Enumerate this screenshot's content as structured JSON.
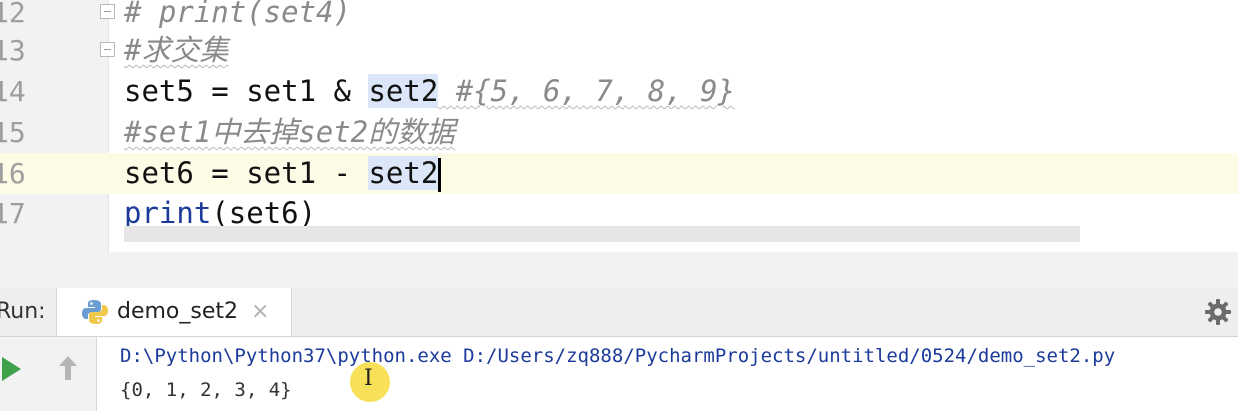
{
  "editor": {
    "lines": [
      {
        "number": "12",
        "text": "# print(set4)"
      },
      {
        "number": "13",
        "text": "#求交集"
      },
      {
        "number": "14",
        "code_a": "set5 = set1 & ",
        "code_hl": "set2",
        "comment": " #{5, 6, 7, 8, 9}"
      },
      {
        "number": "15",
        "text": "#set1中去掉set2的数据"
      },
      {
        "number": "16",
        "code_a": "set6 = set1 - ",
        "code_hl": "set2"
      },
      {
        "number": "17",
        "fn": "print",
        "args": "(set6)"
      }
    ]
  },
  "run": {
    "label": "Run:",
    "tab_label": "demo_set2",
    "tab_close": "×",
    "icons": {
      "tab": "python-icon",
      "settings": "gear-icon",
      "rerun": "play-icon",
      "scroll_up": "up-arrow-icon"
    },
    "console": {
      "command": "D:\\Python\\Python37\\python.exe D:/Users/zq888/PycharmProjects/untitled/0524/demo_set2.py",
      "output": "{0, 1, 2, 3, 4}"
    }
  },
  "colors": {
    "current_line": "#fdfae6",
    "highlight": "#dbe6f8",
    "keyword": "#1b3a9a",
    "comment": "#8a8a8a",
    "run_green": "#3ea14a"
  }
}
